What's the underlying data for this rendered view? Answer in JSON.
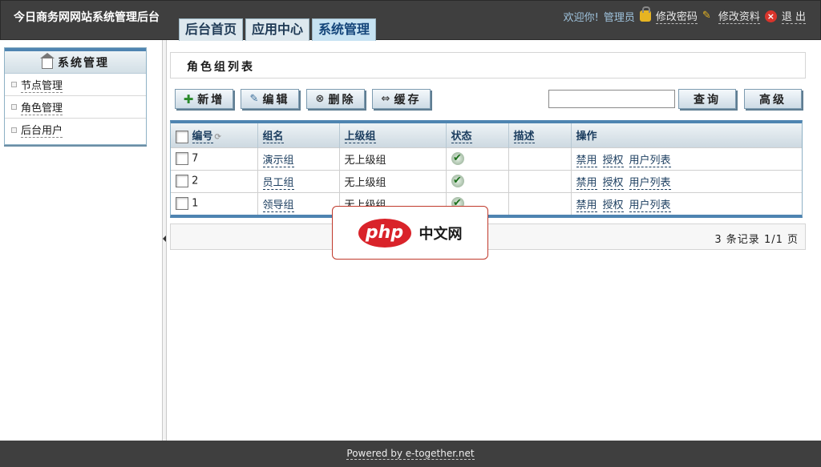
{
  "header": {
    "app_title": "今日商务网网站系统管理后台",
    "tabs": [
      "后台首页",
      "应用中心",
      "系统管理"
    ],
    "active_tab": "系统管理",
    "welcome": "欢迎你!",
    "user": "管理员",
    "change_password": "修改密码",
    "edit_profile": "修改资料",
    "logout": "退 出"
  },
  "sidebar": {
    "title": "系统管理",
    "items": [
      "节点管理",
      "角色管理",
      "后台用户"
    ]
  },
  "main": {
    "page_title": "角色组列表",
    "toolbar": {
      "add": "新增",
      "edit": "编辑",
      "delete": "删除",
      "cache": "缓存",
      "search": "查询",
      "advanced": "高级",
      "search_value": ""
    },
    "table": {
      "headers": [
        "编号",
        "组名",
        "上级组",
        "状态",
        "描述",
        "操作"
      ],
      "rows": [
        {
          "id": "7",
          "name": "演示组",
          "parent": "无上级组",
          "desc": ""
        },
        {
          "id": "2",
          "name": "员工组",
          "parent": "无上级组",
          "desc": ""
        },
        {
          "id": "1",
          "name": "领导组",
          "parent": "无上级组",
          "desc": ""
        }
      ],
      "row_actions": [
        "禁用",
        "授权",
        "用户列表"
      ]
    },
    "pager": "3 条记录 1/1 页"
  },
  "watermark": {
    "logo": "php",
    "text": "中文网"
  },
  "footer": {
    "powered": "Powered by e-together.net"
  },
  "icons": {
    "lock": "lock-icon",
    "pencil": "pencil-icon",
    "exit": "exit-icon",
    "home": "home-icon",
    "check": "check-icon"
  },
  "colors": {
    "header_bg": "#3f3f3f",
    "accent": "#4e84b1",
    "link": "#1a3c5e"
  }
}
